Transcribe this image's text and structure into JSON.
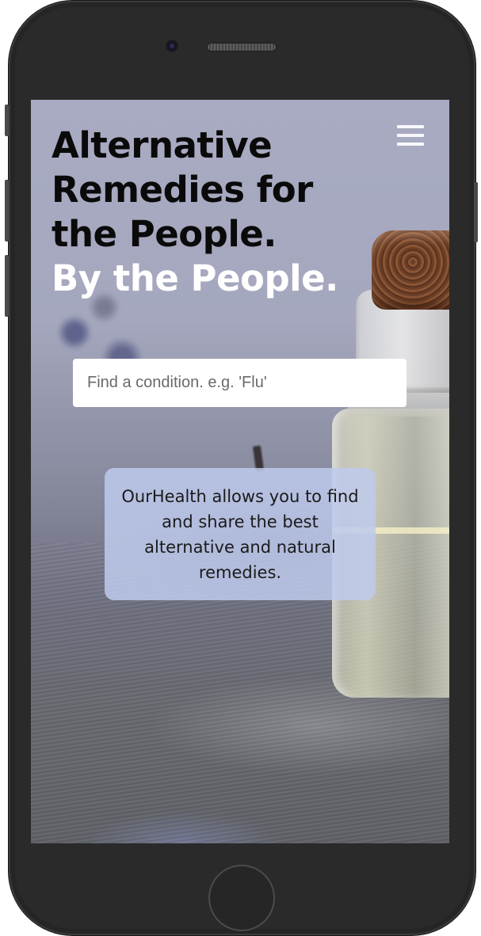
{
  "hero": {
    "title_line1": "Alternative",
    "title_line2": "Remedies for",
    "title_line3": "the People.",
    "title_highlight": "By the People."
  },
  "menu": {
    "icon": "hamburger-menu-icon"
  },
  "search": {
    "placeholder": "Find a condition. e.g. 'Flu'",
    "value": ""
  },
  "info": {
    "text": "OurHealth allows you to find and share the best alternative and natural remedies."
  },
  "device": {
    "frame_color": "#2a2a2a",
    "home_button_icon": "home-button-icon",
    "camera_icon": "front-camera-icon"
  },
  "colors": {
    "headline_dark": "#0a0a0a",
    "headline_light": "#ffffff",
    "card_background": "#becaec",
    "screen_background": "#a4a7bd"
  }
}
